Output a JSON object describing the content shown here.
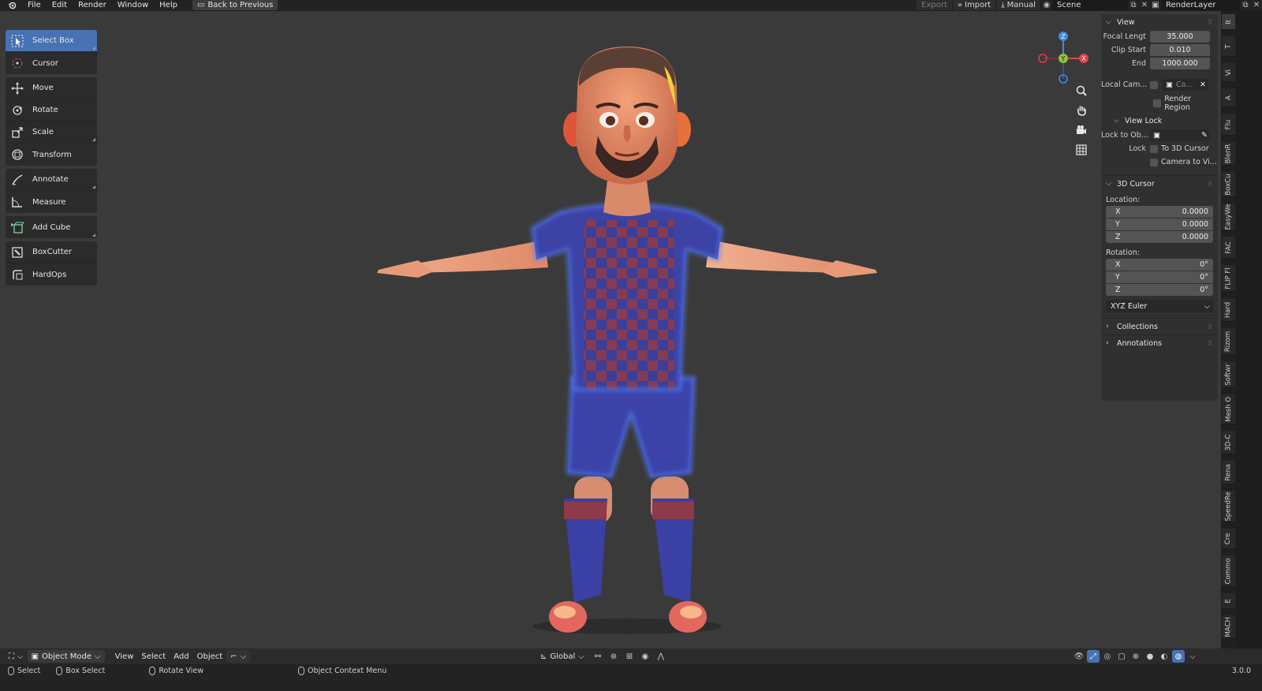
{
  "topbar": {
    "menus": [
      "File",
      "Edit",
      "Render",
      "Window",
      "Help"
    ],
    "back_label": "Back to Previous",
    "export_label": "Export",
    "import_label": "Import",
    "manual_label": "Manual",
    "scene_name": "Scene",
    "layer_name": "RenderLayer"
  },
  "toolbar": {
    "tools": [
      {
        "label": "Select Box",
        "icon": "select-box-icon"
      },
      {
        "label": "Cursor",
        "icon": "cursor-icon"
      },
      {
        "label": "Move",
        "icon": "move-icon"
      },
      {
        "label": "Rotate",
        "icon": "rotate-icon"
      },
      {
        "label": "Scale",
        "icon": "scale-icon"
      },
      {
        "label": "Transform",
        "icon": "transform-icon"
      },
      {
        "label": "Annotate",
        "icon": "annotate-icon"
      },
      {
        "label": "Measure",
        "icon": "measure-icon"
      },
      {
        "label": "Add Cube",
        "icon": "add-cube-icon"
      },
      {
        "label": "BoxCutter",
        "icon": "boxcutter-icon"
      },
      {
        "label": "HardOps",
        "icon": "hardops-icon"
      }
    ]
  },
  "gizmo": {
    "z": "Z",
    "y": "Y",
    "x": "X"
  },
  "npanel": {
    "view_header": "View",
    "focal_label": "Focal Lengt",
    "focal_value": "35.000",
    "clip_start_label": "Clip Start",
    "clip_start_value": "0.010",
    "end_label": "End",
    "end_value": "1000.000",
    "local_cam_label": "Local Cam...",
    "local_cam_value": "Ca...",
    "render_region_label": "Render Region",
    "view_lock_header": "View Lock",
    "lock_to_obj_label": "Lock to Ob...",
    "lock_label": "Lock",
    "to_3d_cursor_label": "To 3D Cursor",
    "camera_to_view_label": "Camera to Vi...",
    "cursor_header": "3D Cursor",
    "location_label": "Location:",
    "location": [
      {
        "axis": "X",
        "value": "0.0000"
      },
      {
        "axis": "Y",
        "value": "0.0000"
      },
      {
        "axis": "Z",
        "value": "0.0000"
      }
    ],
    "rotation_label": "Rotation:",
    "rotation": [
      {
        "axis": "X",
        "value": "0°"
      },
      {
        "axis": "Y",
        "value": "0°"
      },
      {
        "axis": "Z",
        "value": "0°"
      }
    ],
    "rotation_mode": "XYZ Euler",
    "collections_header": "Collections",
    "annotations_header": "Annotations"
  },
  "vtabs": [
    "It",
    "T",
    "Vi",
    "A",
    "Flu",
    "BlenR",
    "BoxCu",
    "EasyWe",
    "FAC",
    "FLIP Fl",
    "Hard",
    "Rizom",
    "Softwr",
    "Mesh O",
    "3D-C",
    "Rena",
    "SpeedRe",
    "Cre",
    "Commo",
    "E",
    "MACH"
  ],
  "bottombar": {
    "mode_label": "Object Mode",
    "menus": [
      "View",
      "Select",
      "Add",
      "Object"
    ],
    "orientation_label": "Global"
  },
  "statusbar": {
    "select_label": "Select",
    "box_select_label": "Box Select",
    "rotate_view_label": "Rotate View",
    "context_menu_label": "Object Context Menu",
    "version": "3.0.0"
  },
  "colors": {
    "accent": "#4772b3",
    "viewport_bg": "#3a3a3a",
    "panel_bg": "#303030",
    "gizmo_x": "#e0414f",
    "gizmo_y": "#8bc53f",
    "gizmo_z": "#3b8de0"
  }
}
